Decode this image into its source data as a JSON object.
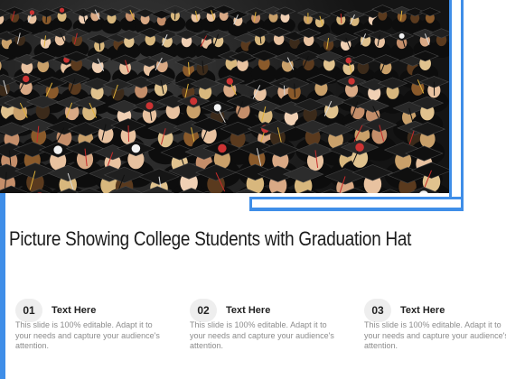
{
  "title": "Picture Showing College Students with Graduation Hat",
  "photo": {
    "subject": "crowd of graduates wearing black caps and gowns",
    "accent": "#3f8ee8"
  },
  "steps": [
    {
      "number": "01",
      "heading": "Text Here",
      "description": "This slide is 100% editable. Adapt it to your needs and capture your audience's attention."
    },
    {
      "number": "02",
      "heading": "Text Here",
      "description": "This slide is 100% editable. Adapt it to your needs and capture your audience's attention."
    },
    {
      "number": "03",
      "heading": "Text Here",
      "description": "This slide is 100% editable. Adapt it to your needs and capture your audience's attention."
    }
  ]
}
